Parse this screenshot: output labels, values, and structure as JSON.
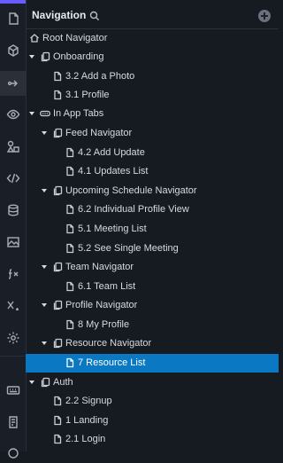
{
  "panel": {
    "title": "Navigation",
    "search_icon": "search-icon",
    "add_icon": "add-circle-icon"
  },
  "colors": {
    "selection": "#0a78c2",
    "accent": "#6b5cff",
    "background": "#161b22"
  },
  "rail": [
    {
      "name": "pages-icon"
    },
    {
      "name": "components-icon"
    },
    {
      "name": "navigation-icon",
      "active": true
    },
    {
      "name": "preview-icon"
    },
    {
      "name": "assets-icon"
    },
    {
      "name": "code-icon"
    },
    {
      "name": "database-icon"
    },
    {
      "name": "media-icon"
    },
    {
      "name": "functions-icon"
    },
    {
      "name": "variables-icon"
    },
    {
      "name": "settings-icon"
    },
    {
      "name": "keyboard-icon"
    },
    {
      "name": "docs-icon"
    }
  ],
  "tree": [
    {
      "label": "Root Navigator",
      "icon": "home-icon",
      "expandable": false
    },
    {
      "label": "Onboarding",
      "icon": "stack-icon",
      "expandable": true
    },
    {
      "label": "3.2 Add a Photo",
      "icon": "page-icon",
      "expandable": false
    },
    {
      "label": "3.1 Profile",
      "icon": "page-icon",
      "expandable": false
    },
    {
      "label": "In App Tabs",
      "icon": "tabs-icon",
      "expandable": true
    },
    {
      "label": "Feed Navigator",
      "icon": "stack-icon",
      "expandable": true
    },
    {
      "label": "4.2 Add Update",
      "icon": "page-icon",
      "expandable": false
    },
    {
      "label": "4.1 Updates List",
      "icon": "page-icon",
      "expandable": false
    },
    {
      "label": "Upcoming Schedule Navigator",
      "icon": "stack-icon",
      "expandable": true
    },
    {
      "label": "6.2 Individual Profile View",
      "icon": "page-icon",
      "expandable": false
    },
    {
      "label": "5.1 Meeting List",
      "icon": "page-icon",
      "expandable": false
    },
    {
      "label": "5.2 See Single Meeting",
      "icon": "page-icon",
      "expandable": false
    },
    {
      "label": "Team Navigator",
      "icon": "stack-icon",
      "expandable": true
    },
    {
      "label": "6.1 Team List",
      "icon": "page-icon",
      "expandable": false
    },
    {
      "label": "Profile Navigator",
      "icon": "stack-icon",
      "expandable": true
    },
    {
      "label": "8 My Profile",
      "icon": "page-icon",
      "expandable": false
    },
    {
      "label": "Resource Navigator",
      "icon": "stack-icon",
      "expandable": true
    },
    {
      "label": "7 Resource List",
      "icon": "page-icon",
      "expandable": false,
      "selected": true
    },
    {
      "label": "Auth",
      "icon": "stack-icon",
      "expandable": true
    },
    {
      "label": "2.2 Signup",
      "icon": "page-icon",
      "expandable": false
    },
    {
      "label": "1 Landing",
      "icon": "page-icon",
      "expandable": false
    },
    {
      "label": "2.1 Login",
      "icon": "page-icon",
      "expandable": false
    }
  ]
}
